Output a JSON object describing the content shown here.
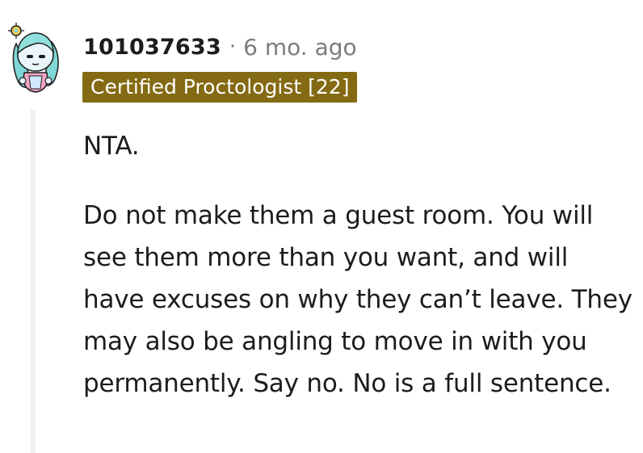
{
  "comment": {
    "username": "101037633",
    "separator": "·",
    "timestamp": "6 mo. ago",
    "flair": "Certified Proctologist [22]",
    "flair_color": "#846a12",
    "avatar_icon": "snoo-avatar-icon",
    "paragraphs": [
      "NTA.",
      "Do not make them a guest room. You will see them more than you want, and will have excuses on why they can’t leave. They may also be angling to move in with you permanently. Say no. No is a full sentence."
    ]
  }
}
